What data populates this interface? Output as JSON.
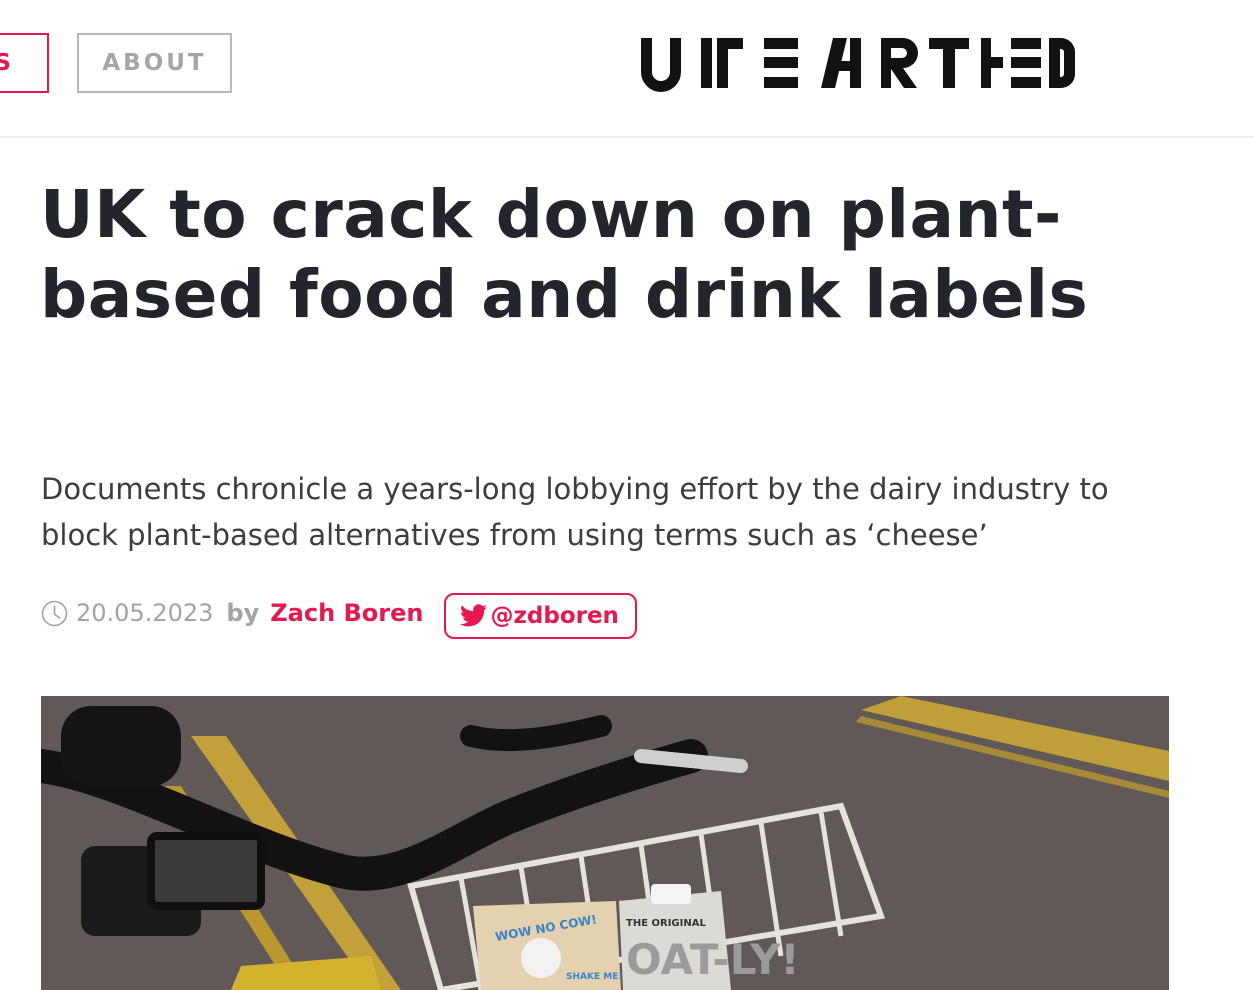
{
  "header": {
    "nav": {
      "news_label": "S",
      "about_label": "ABOUT"
    },
    "logo_text": "UNEARTHED"
  },
  "article": {
    "headline": "UK to crack down on plant-based food and drink labels",
    "standfirst": "Documents chronicle a years-long lobbying effort by the dairy industry to block plant-based alternatives from using terms such as ‘cheese’",
    "date": "20.05.2023",
    "by_label": "by",
    "author": "Zach Boren",
    "twitter_handle": "@zdboren"
  },
  "hero_image": {
    "carton_left_text": "WOW NO COW!",
    "carton_left_sub": "SHAKE ME!",
    "carton_right_top": "THE ORIGINAL",
    "carton_right_brand": "OAT-LY!"
  },
  "colors": {
    "accent": "#e4194f",
    "text": "#22252b",
    "muted": "#a3a3a3"
  },
  "icons": {
    "clock": "clock-icon",
    "twitter": "twitter-icon"
  }
}
